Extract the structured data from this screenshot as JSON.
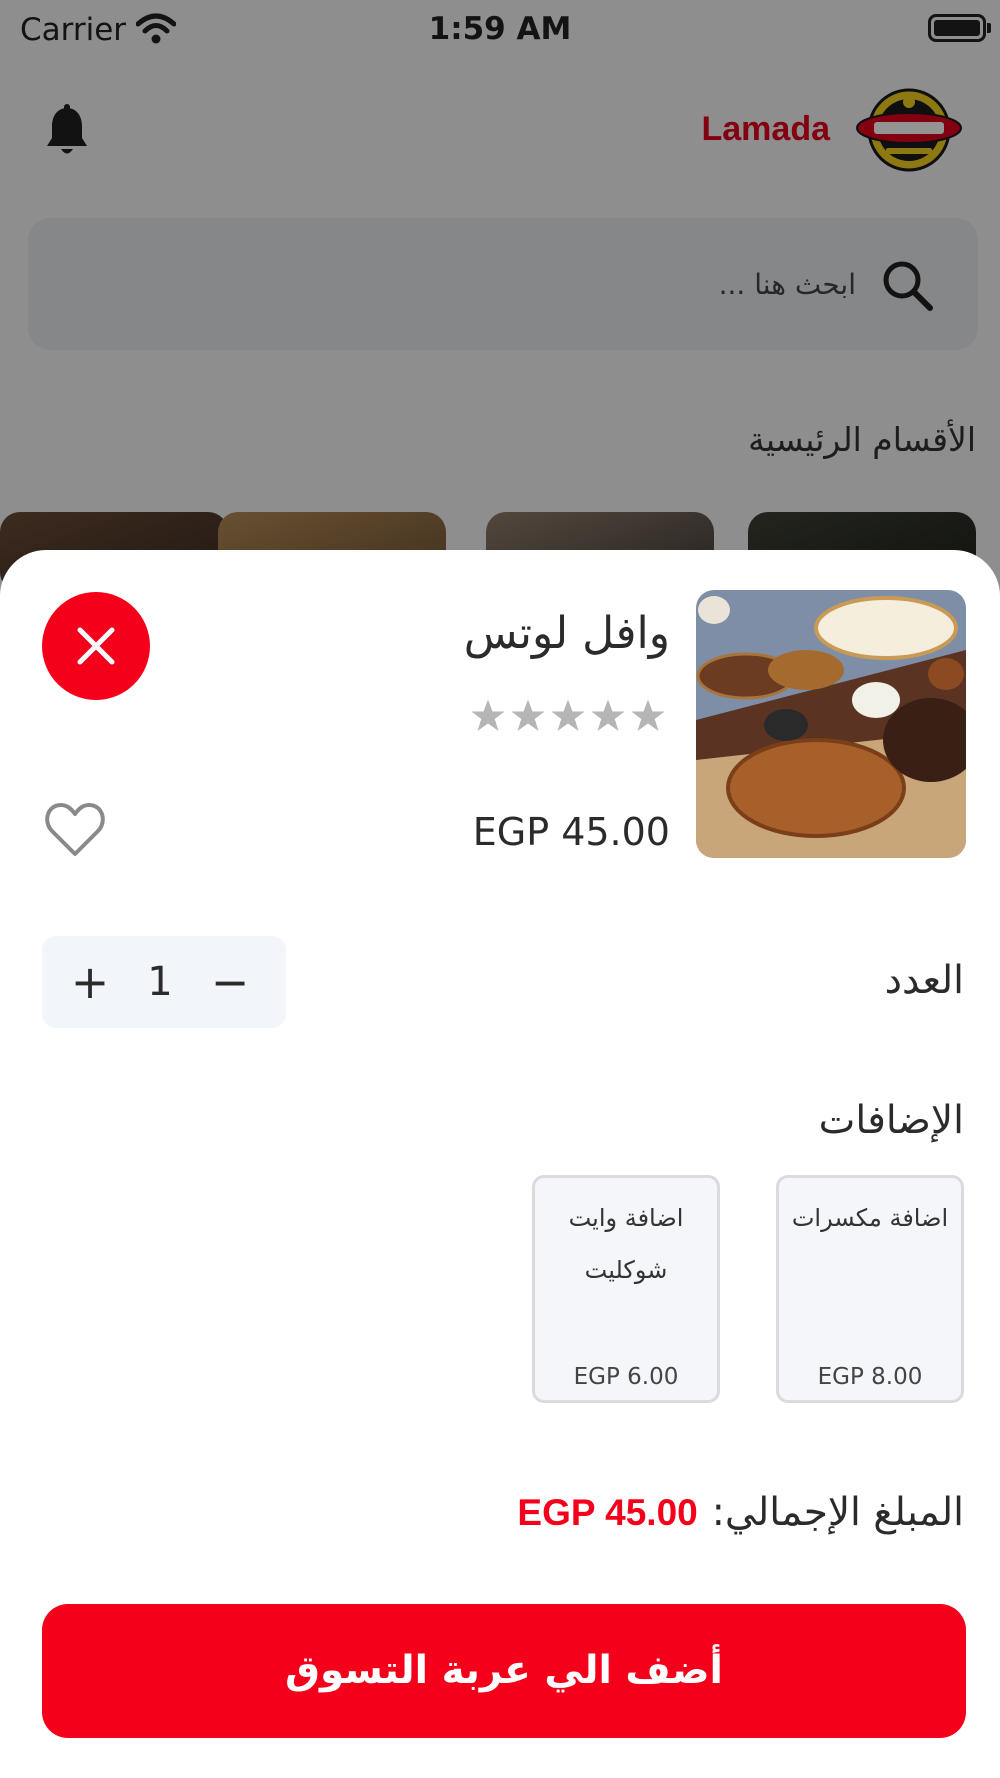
{
  "status_bar": {
    "carrier": "Carrier",
    "time": "1:59 AM",
    "wifi_icon": "wifi-icon",
    "battery_icon": "battery-icon"
  },
  "header": {
    "brand_name": "Lamada",
    "brand_color": "#e0001b",
    "bell_icon": "bell-icon",
    "logo_icon": "lamada-logo"
  },
  "search": {
    "placeholder": "ابحث هنا ..."
  },
  "categories": {
    "title": "الأقسام الرئيسية"
  },
  "product": {
    "name": "وافل لوتس",
    "price": "EGP 45.00",
    "rating": 0,
    "rating_max": 5
  },
  "quantity": {
    "label": "العدد",
    "value": "1",
    "plus": "+",
    "minus": "−"
  },
  "addons": {
    "title": "الإضافات",
    "items": [
      {
        "name": "اضافة مكسرات",
        "price": "EGP 8.00"
      },
      {
        "name": "اضافة وايت شوكليت",
        "price": "EGP 6.00"
      }
    ]
  },
  "total": {
    "label": "المبلغ الإجمالي:",
    "value": "EGP 45.00"
  },
  "cta": {
    "label": "أضف الي عربة التسوق"
  },
  "colors": {
    "accent": "#f5001b",
    "star_inactive": "#b5b5b5",
    "sheet_background": "#ffffff",
    "stepper_background": "#f2f5fa"
  }
}
